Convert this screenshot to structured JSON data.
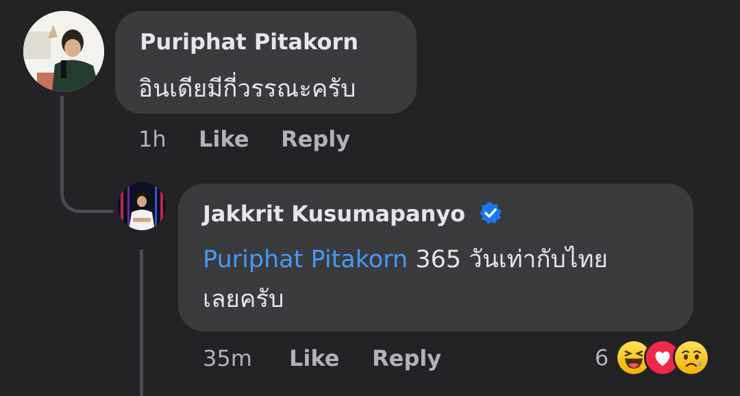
{
  "comments": [
    {
      "author": "Puriphat Pitakorn",
      "text": "อินเดียมีกี่วรรณะครับ",
      "time": "1h",
      "like_label": "Like",
      "reply_label": "Reply"
    }
  ],
  "reply": {
    "author": "Jakkrit Kusumapanyo",
    "verified": true,
    "mention": "Puriphat Pitakorn",
    "text_line1": "365 วันเท่ากับไทย",
    "text_line2": "เลยครับ",
    "time": "35m",
    "like_label": "Like",
    "reply_label": "Reply",
    "reaction_count": "6",
    "reactions": [
      "haha-icon",
      "love-icon",
      "sad-icon"
    ]
  },
  "colors": {
    "background": "#232325",
    "bubble": "#3a3b3c",
    "text": "#e4e6eb",
    "meta": "#b0b3b8",
    "mention": "#4599ff",
    "verified": "#1877f2"
  }
}
